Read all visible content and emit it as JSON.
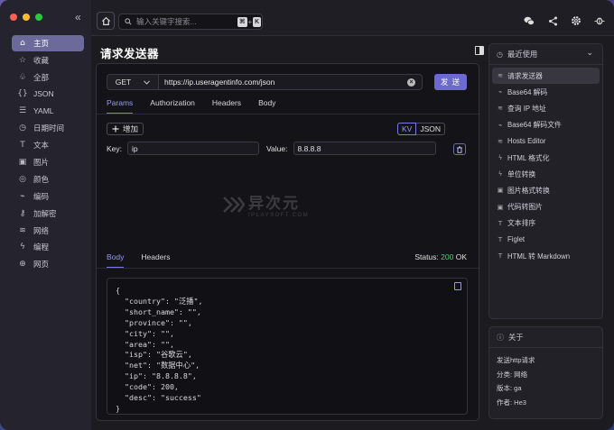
{
  "sidebar": {
    "items": [
      {
        "icon": "⌂",
        "label": "主页",
        "active": true
      },
      {
        "icon": "☆",
        "label": "收藏"
      },
      {
        "icon": "♧",
        "label": "全部"
      },
      {
        "icon": "{}",
        "label": "JSON"
      },
      {
        "icon": "☰",
        "label": "YAML"
      },
      {
        "icon": "◷",
        "label": "日期时间"
      },
      {
        "icon": "T",
        "label": "文本"
      },
      {
        "icon": "▣",
        "label": "图片"
      },
      {
        "icon": "◎",
        "label": "颜色"
      },
      {
        "icon": "⌁",
        "label": "编码"
      },
      {
        "icon": "⚷",
        "label": "加解密"
      },
      {
        "icon": "≋",
        "label": "网络"
      },
      {
        "icon": "ϟ",
        "label": "编程"
      },
      {
        "icon": "⊕",
        "label": "网页"
      }
    ]
  },
  "topbar": {
    "search_placeholder": "输入关键字搜索...",
    "shortcut_key1": "⌘",
    "shortcut_plus": "+",
    "shortcut_key2": "K"
  },
  "main": {
    "title": "请求发送器",
    "method": "GET",
    "url": "https://ip.useragentinfo.com/json",
    "send_label": "发 送",
    "tabs": [
      "Params",
      "Authorization",
      "Headers",
      "Body"
    ],
    "add_label": "增加",
    "kv_label": "KV",
    "json_label": "JSON",
    "key_label": "Key:",
    "key_value": "ip",
    "value_label": "Value:",
    "value_value": "8.8.8.8",
    "watermark": "异次元",
    "watermark_sub": "IPLAYSOFT.COM",
    "response_tabs": [
      "Body",
      "Headers"
    ],
    "status_label": "Status:",
    "status_code": "200",
    "status_text": "OK",
    "response_body": "{\n  \"country\": \"泛播\",\n  \"short_name\": \"\",\n  \"province\": \"\",\n  \"city\": \"\",\n  \"area\": \"\",\n  \"isp\": \"谷歌云\",\n  \"net\": \"数据中心\",\n  \"ip\": \"8.8.8.8\",\n  \"code\": 200,\n  \"desc\": \"success\"\n}"
  },
  "recent": {
    "title": "最近使用",
    "items": [
      {
        "icon": "≋",
        "label": "请求发送器",
        "active": true
      },
      {
        "icon": "⌁",
        "label": "Base64 解码"
      },
      {
        "icon": "≋",
        "label": "查询 IP 地址"
      },
      {
        "icon": "⌁",
        "label": "Base64 解码文件"
      },
      {
        "icon": "≋",
        "label": "Hosts Editor"
      },
      {
        "icon": "ϟ",
        "label": "HTML 格式化"
      },
      {
        "icon": "ϟ",
        "label": "单位转换"
      },
      {
        "icon": "▣",
        "label": "图片格式转换"
      },
      {
        "icon": "▣",
        "label": "代码转图片"
      },
      {
        "icon": "T",
        "label": "文本排序"
      },
      {
        "icon": "T",
        "label": "Figlet"
      },
      {
        "icon": "T",
        "label": "HTML 转 Markdown"
      }
    ]
  },
  "about": {
    "title": "关于",
    "description": "发送http请求",
    "category": "分类: 网络",
    "version": "版本: ga",
    "author": "作者: He3"
  },
  "colors": {
    "accent": "#6c6ad0",
    "status_ok": "#4cd07a"
  }
}
